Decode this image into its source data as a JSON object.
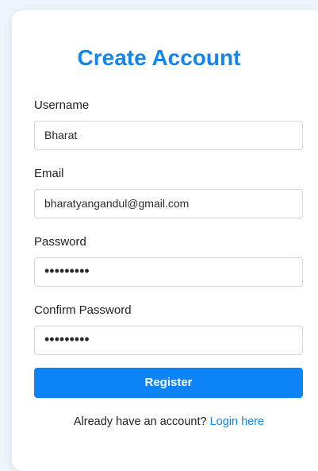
{
  "form": {
    "title": "Create Account",
    "username": {
      "label": "Username",
      "value": "Bharat"
    },
    "email": {
      "label": "Email",
      "value": "bharatyangandul@gmail.com"
    },
    "password": {
      "label": "Password",
      "value": "•••••••••"
    },
    "confirm_password": {
      "label": "Confirm Password",
      "value": "•••••••••"
    },
    "register_label": "Register",
    "footer_text": "Already have an account?",
    "login_link": "Login here"
  },
  "colors": {
    "accent": "#1585ee",
    "button": "#0d83f8",
    "page_background": "#eef4fb",
    "card": "#ffffff",
    "field_border": "#cfd6dd"
  }
}
